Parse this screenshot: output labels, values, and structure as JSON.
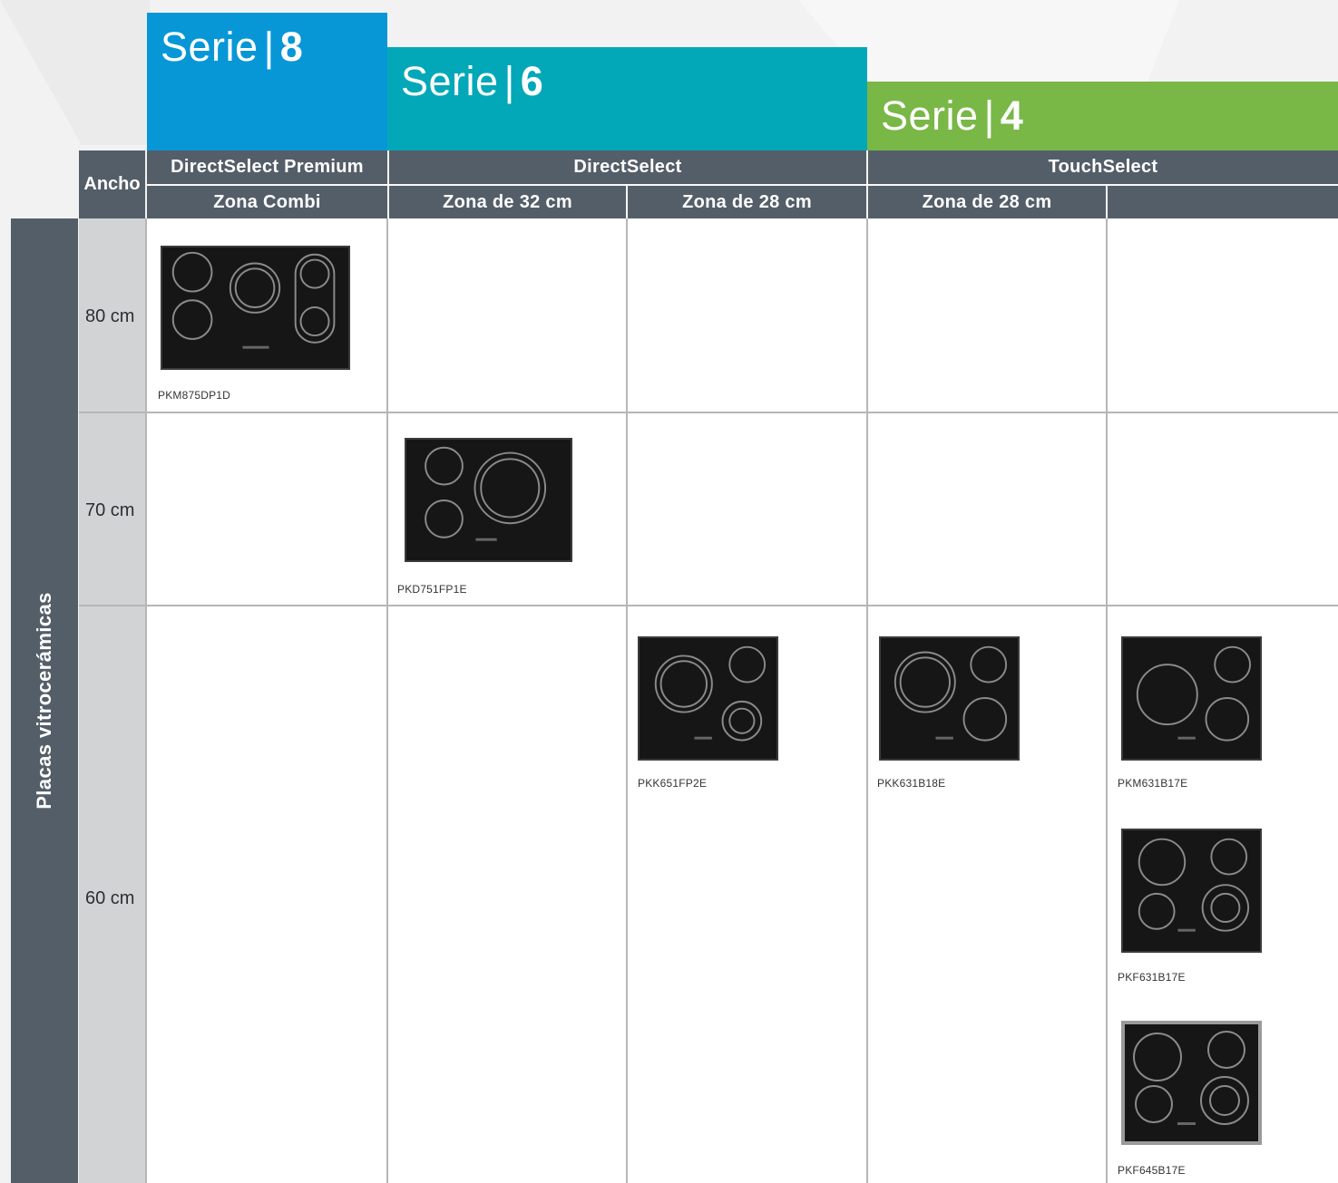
{
  "series": [
    {
      "prefix": "Serie",
      "number": "8",
      "color": "#0797d6"
    },
    {
      "prefix": "Serie",
      "number": "6",
      "color": "#03a8b8"
    },
    {
      "prefix": "Serie",
      "number": "4",
      "color": "#79b746"
    }
  ],
  "header": {
    "ancho": "Ancho",
    "lines": [
      "DirectSelect Premium",
      "DirectSelect",
      "TouchSelect"
    ],
    "zones": [
      "Zona Combi",
      "Zona de 32 cm",
      "Zona de 28 cm",
      "Zona de 28 cm",
      ""
    ]
  },
  "category": "Placas vitrocerámicas",
  "widths": [
    "80 cm",
    "70 cm",
    "60 cm"
  ],
  "products": [
    {
      "model": "PKM875DP1D",
      "image": "hob-4-zones-80cm"
    },
    {
      "model": "PKD751FP1E",
      "image": "hob-3-zones-70cm"
    },
    {
      "model": "PKK651FP2E",
      "image": "hob-3-zones-60cm"
    },
    {
      "model": "PKK631B18E",
      "image": "hob-3-zones-60cm"
    },
    {
      "model": "PKM631B17E",
      "image": "hob-3-zones-60cm"
    },
    {
      "model": "PKF631B17E",
      "image": "hob-4-zones-60cm"
    },
    {
      "model": "PKF645B17E",
      "image": "hob-4-zones-60cm-steel-frame"
    }
  ],
  "colors": {
    "header": "#545e69",
    "width_column": "#d2d3d5",
    "grid_line": "#b6b6b6"
  }
}
